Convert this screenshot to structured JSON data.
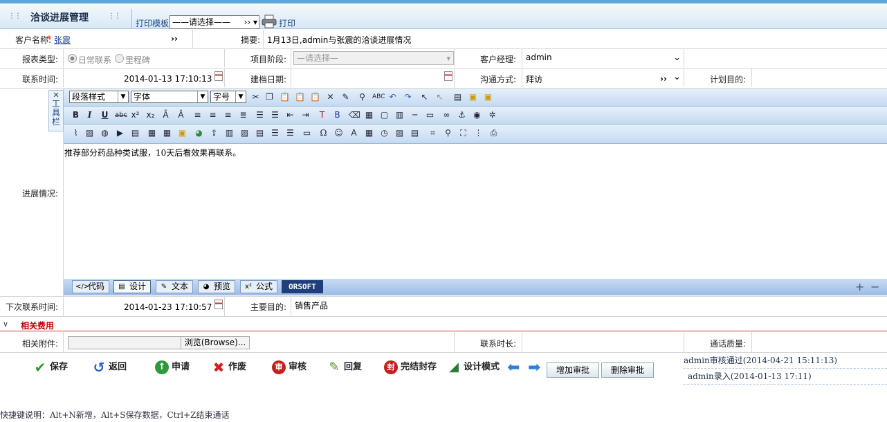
{
  "header": {
    "title": "洽谈进展管理",
    "print_template_label": "打印模板",
    "template_select_value": "——请选择——",
    "template_select_arrow": "››",
    "print_label": "打印"
  },
  "row1": {
    "customer_label": "客户名称:",
    "required_mark": "*",
    "customer_value": "张震",
    "customer_arrow": "››",
    "summary_label": "摘要:",
    "summary_value": "1月13日,admin与张震的洽谈进展情况"
  },
  "row2": {
    "report_type_label": "报表类型:",
    "report_type_options": [
      "日常联系",
      "里程碑"
    ],
    "project_stage_label": "项目阶段:",
    "project_stage_placeholder": "—请选择—",
    "manager_label": "客户经理:",
    "manager_value": "admin"
  },
  "row3": {
    "contact_time_label": "联系时间:",
    "contact_time_value": "2014-01-13 17:10:13",
    "file_date_label": "建档日期:",
    "comm_method_label": "沟通方式:",
    "comm_method_value": "拜访",
    "comm_method_arrow": "››",
    "plan_purpose_label": "计划目的:"
  },
  "editor": {
    "side_tab": "工具栏",
    "paragraph_select": "段落样式",
    "font_select": "字体",
    "size_select": "字号",
    "content": "推荐部分药品种类试服，10天后看效果再联系。",
    "modes": [
      "代码",
      "设计",
      "文本",
      "预览",
      "公式"
    ],
    "brand": "ORSOFT"
  },
  "progress_label": "进展情况:",
  "row_next": {
    "next_contact_label": "下次联系时间:",
    "next_contact_value": "2014-01-23 17:10:57",
    "main_purpose_label": "主要目的:",
    "main_purpose_value": "销售产品"
  },
  "section": {
    "title": "相关费用",
    "toggle": "∨"
  },
  "row_attach": {
    "attachment_label": "相关附件:",
    "browse_label": "浏览(Browse)...",
    "duration_label": "联系时长:",
    "quality_label": "通话质量:"
  },
  "actions": {
    "save": "保存",
    "back": "返回",
    "apply": "申请",
    "void": "作废",
    "audit": "审核",
    "reply": "回复",
    "seal": "完结封存",
    "design_mode": "设计模式",
    "add_approval": "增加审批",
    "delete_approval": "删除审批"
  },
  "history": [
    "admin审核通过(2014-04-21 15:11:13)",
    "admin录入(2014-01-13 17:11)"
  ],
  "footer": "快捷键说明：Alt+N新增，Alt+S保存数据，Ctrl+Z结束通话",
  "colors": {
    "accent": "#5aa8dc",
    "toolbar": "#c4daf2",
    "section_title": "#bb0000"
  }
}
